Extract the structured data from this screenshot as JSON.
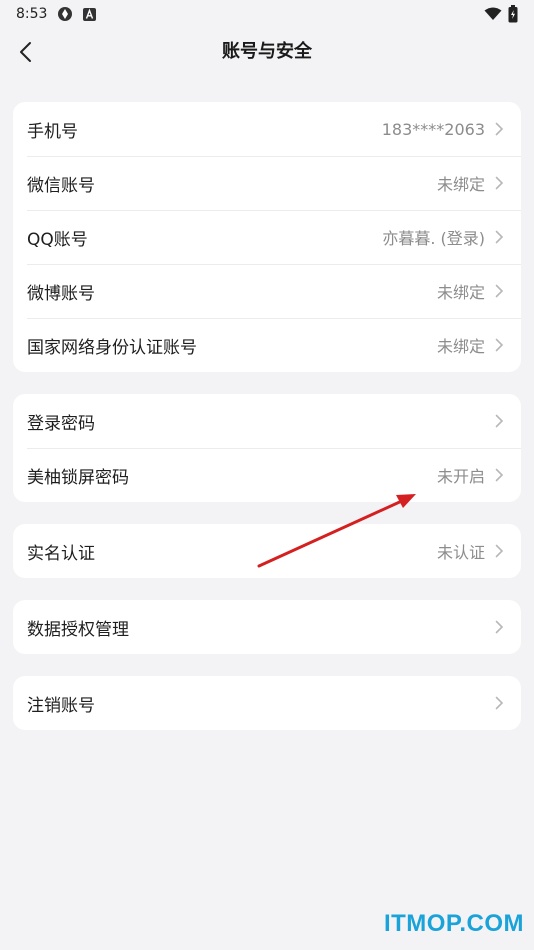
{
  "status_bar": {
    "time": "8:53",
    "icons": [
      "vpn-icon",
      "a-icon",
      "wifi-icon",
      "battery-icon"
    ]
  },
  "header": {
    "title": "账号与安全",
    "back_icon": "chevron-left-icon"
  },
  "groups": [
    {
      "rows": [
        {
          "label": "手机号",
          "value": "183****2063"
        },
        {
          "label": "微信账号",
          "value": "未绑定"
        },
        {
          "label": "QQ账号",
          "value": "亦暮暮. (登录)"
        },
        {
          "label": "微博账号",
          "value": "未绑定"
        },
        {
          "label": "国家网络身份认证账号",
          "value": "未绑定"
        }
      ]
    },
    {
      "rows": [
        {
          "label": "登录密码",
          "value": ""
        },
        {
          "label": "美柚锁屏密码",
          "value": "未开启"
        }
      ]
    },
    {
      "rows": [
        {
          "label": "实名认证",
          "value": "未认证"
        }
      ]
    },
    {
      "rows": [
        {
          "label": "数据授权管理",
          "value": ""
        }
      ]
    },
    {
      "rows": [
        {
          "label": "注销账号",
          "value": ""
        }
      ]
    }
  ],
  "watermark": "ITMOP.COM",
  "colors": {
    "background": "#f3f3f5",
    "card": "#ffffff",
    "value_text": "#8c8c8c",
    "annotation_arrow": "#d42020",
    "watermark": "#1aa3d9"
  }
}
